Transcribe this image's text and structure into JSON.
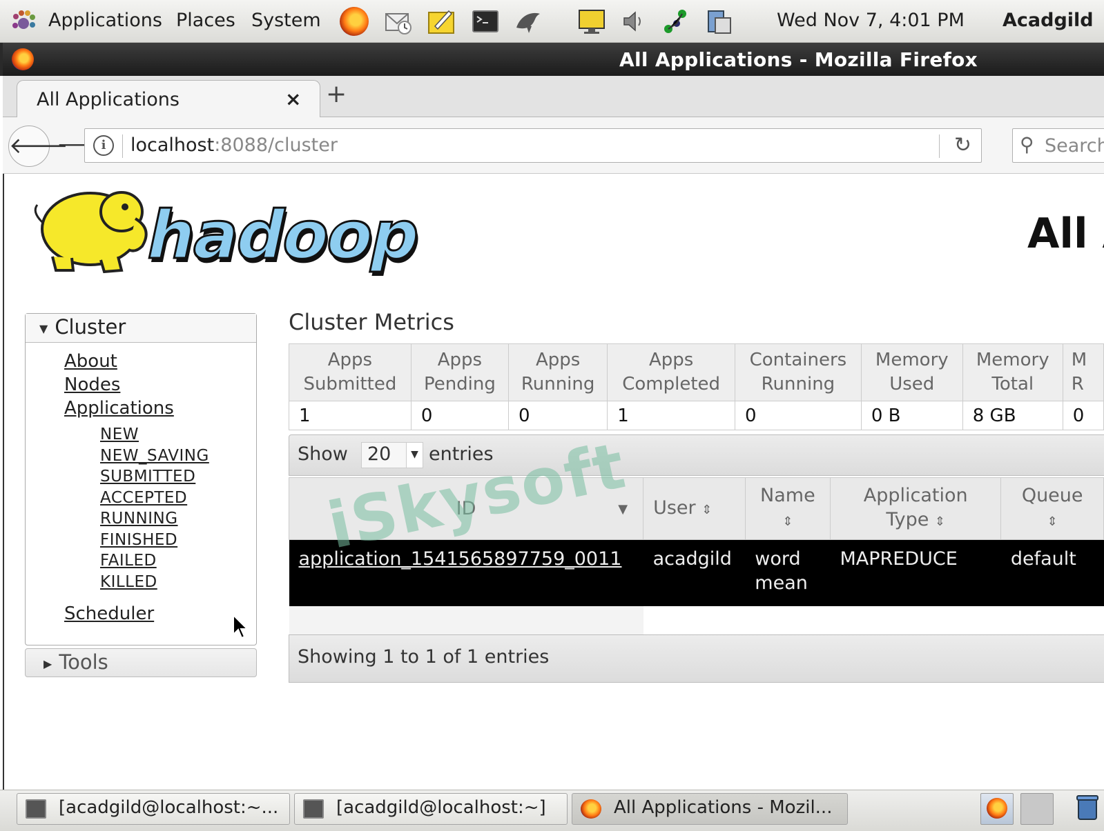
{
  "panel": {
    "menu_applications": "Applications",
    "menu_places": "Places",
    "menu_system": "System",
    "clock": "Wed Nov  7,  4:01 PM",
    "user": "Acadgild",
    "launchers": [
      "firefox-icon",
      "mail-icon",
      "notes-icon",
      "terminal-icon",
      "dolphin-icon"
    ],
    "tray": [
      "display-icon",
      "volume-icon",
      "network-icon",
      "clipboard-icon"
    ]
  },
  "window": {
    "title": "All Applications - Mozilla Firefox"
  },
  "browser": {
    "tab_label": "All Applications",
    "tab_close": "×",
    "new_tab": "+",
    "url_host": "localhost",
    "url_rest": ":8088/cluster",
    "search_placeholder": "Search"
  },
  "page": {
    "title": "All A",
    "logo_text": "hadoop",
    "nav": {
      "cluster_heading": "Cluster",
      "links": [
        "About",
        "Nodes",
        "Applications"
      ],
      "states": [
        "NEW",
        "NEW_SAVING",
        "SUBMITTED",
        "ACCEPTED",
        "RUNNING",
        "FINISHED",
        "FAILED",
        "KILLED"
      ],
      "scheduler": "Scheduler",
      "tools_heading": "Tools"
    },
    "metrics": {
      "title": "Cluster Metrics",
      "headers": [
        [
          "Apps",
          "Submitted"
        ],
        [
          "Apps",
          "Pending"
        ],
        [
          "Apps",
          "Running"
        ],
        [
          "Apps",
          "Completed"
        ],
        [
          "Containers",
          "Running"
        ],
        [
          "Memory",
          "Used"
        ],
        [
          "Memory",
          "Total"
        ],
        [
          "M",
          "R"
        ]
      ],
      "values": [
        "1",
        "0",
        "0",
        "1",
        "0",
        "0 B",
        "8 GB",
        "0"
      ]
    },
    "table_controls": {
      "show": "Show",
      "page_size": "20",
      "entries": "entries",
      "footer": "Showing 1 to 1 of 1 entries"
    },
    "apps": {
      "headers": [
        "ID",
        "User",
        "Name",
        "Application Type",
        "Queue"
      ],
      "rows": [
        {
          "id": "application_1541565897759_0011",
          "user": "acadgild",
          "name": "word mean",
          "type": "MAPREDUCE",
          "queue": "default"
        }
      ]
    },
    "watermark": "iSkysoft"
  },
  "taskbar": {
    "items": [
      "[acadgild@localhost:~...",
      "[acadgild@localhost:~]",
      "All Applications - Mozil..."
    ]
  }
}
